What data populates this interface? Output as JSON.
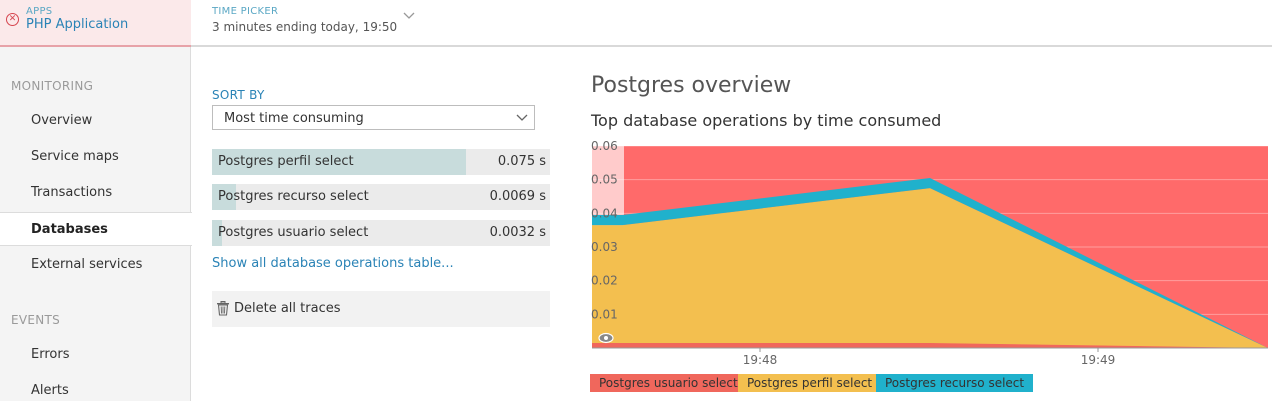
{
  "app": {
    "kicker": "APPS",
    "name": "PHP Application"
  },
  "time_picker": {
    "kicker": "TIME PICKER",
    "value": "3 minutes ending today, 19:50"
  },
  "sidebar": {
    "sections": [
      {
        "title": "MONITORING",
        "items": [
          "Overview",
          "Service maps",
          "Transactions",
          "Databases",
          "External services"
        ]
      },
      {
        "title": "EVENTS",
        "items": [
          "Errors",
          "Alerts"
        ]
      }
    ],
    "active_item": "Databases"
  },
  "sort": {
    "label": "SORT BY",
    "selected": "Most time consuming"
  },
  "operations": [
    {
      "name": "Postgres perfil select",
      "time": "0.075 s",
      "share": 0.75
    },
    {
      "name": "Postgres recurso select",
      "time": "0.0069 s",
      "share": 0.07
    },
    {
      "name": "Postgres usuario select",
      "time": "0.0032 s",
      "share": 0.03
    }
  ],
  "show_all_link": "Show all database operations table...",
  "delete_label": "Delete all traces",
  "overview_title": "Postgres overview",
  "chart_data": {
    "type": "area",
    "title": "Top database operations by time consumed",
    "xlabel": "",
    "ylabel": "",
    "x": [
      "19:47:30",
      "19:48:30",
      "19:49:30"
    ],
    "x_tick_labels": [
      "19:48",
      "19:49"
    ],
    "ylim": [
      0,
      0.06
    ],
    "y_ticks": [
      "0.01",
      "0.02",
      "0.03",
      "0.04",
      "0.05",
      "0.06"
    ],
    "stacked": true,
    "grid": true,
    "legend_position": "bottom-left",
    "series": [
      {
        "name": "Postgres usuario select",
        "color": "#f0675c",
        "values": [
          0.0015,
          0.0015,
          0.0
        ]
      },
      {
        "name": "Postgres perfil select",
        "color": "#f3bf4f",
        "values": [
          0.035,
          0.046,
          0.0
        ]
      },
      {
        "name": "Postgres recurso select",
        "color": "#20b1cc",
        "values": [
          0.003,
          0.003,
          0.0
        ]
      }
    ],
    "background_color": "#ff6a6a"
  },
  "colors": {
    "accent": "#2a83b6",
    "alert_band": "#ff6a6a"
  }
}
